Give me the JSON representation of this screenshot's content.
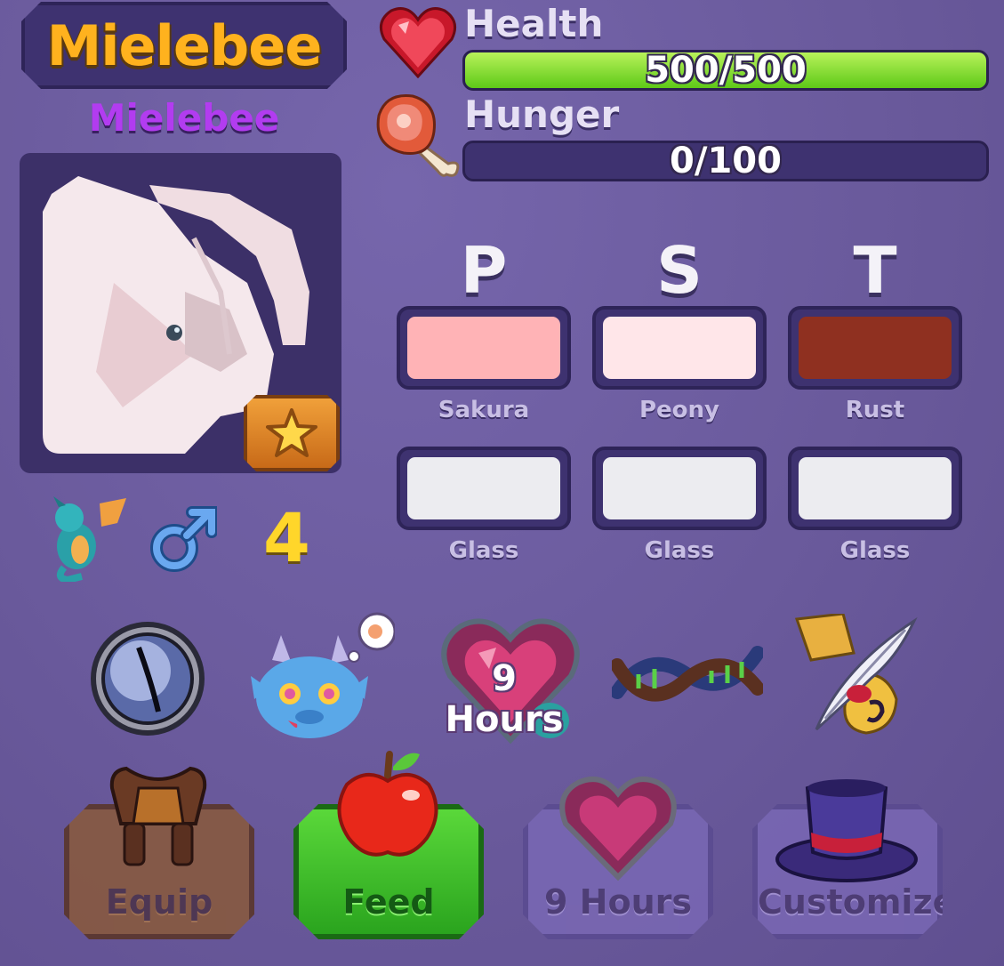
{
  "creature": {
    "title": "Mielebee",
    "nickname": "Mielebee",
    "level": "4",
    "gender_icon": "male-symbol-icon",
    "species_icon": "teal-dragon-icon"
  },
  "stats": {
    "health": {
      "label": "Health",
      "text": "500/500",
      "current": 500,
      "max": 500,
      "fill_fraction": 1.0,
      "color": "#6fd421"
    },
    "hunger": {
      "label": "Hunger",
      "text": "0/100",
      "current": 0,
      "max": 100,
      "fill_fraction": 0.0,
      "color": "#6fd421"
    }
  },
  "colors": {
    "headers": [
      "P",
      "S",
      "T"
    ],
    "primary_row": [
      {
        "name": "Sakura",
        "hex": "#ffb3b6"
      },
      {
        "name": "Peony",
        "hex": "#ffe6e9"
      },
      {
        "name": "Rust",
        "hex": "#8f3020"
      }
    ],
    "secondary_row": [
      {
        "name": "Glass",
        "hex": "#ececf0"
      },
      {
        "name": "Glass",
        "hex": "#ececf0"
      },
      {
        "name": "Glass",
        "hex": "#ececf0"
      }
    ]
  },
  "traits": {
    "items": [
      "eye-icon",
      "mood-dragon-icon",
      "breeding-heart-icon",
      "dna-icon",
      "quill-scroll-icon"
    ],
    "breeding_timer": "9 Hours"
  },
  "actions": {
    "equip": "Equip",
    "feed": "Feed",
    "breed": "9 Hours",
    "customize": "Customize"
  }
}
